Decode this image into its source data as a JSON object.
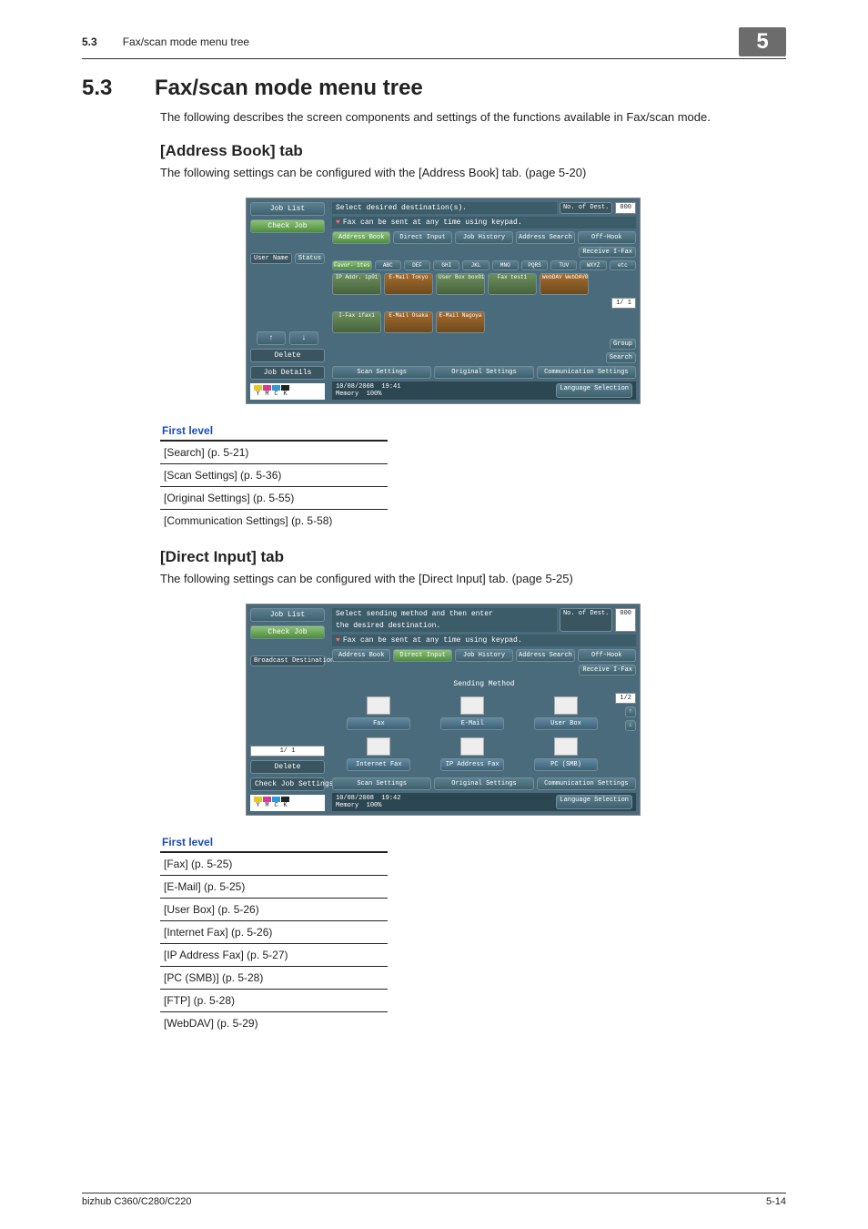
{
  "header": {
    "section_number": "5.3",
    "section_title": "Fax/scan mode menu tree",
    "chapter_badge": "5"
  },
  "h1": {
    "number": "5.3",
    "title": "Fax/scan mode menu tree"
  },
  "intro": "The following describes the screen components and settings of the functions available in Fax/scan mode.",
  "address_tab": {
    "heading": "[Address Book] tab",
    "desc": "The following settings can be configured with the [Address Book] tab. (page 5-20)"
  },
  "direct_tab": {
    "heading": "[Direct Input] tab",
    "desc": "The following settings can be configured with the [Direct Input] tab. (page 5-25)"
  },
  "table_header": "First level",
  "address_levels": [
    "[Search] (p. 5-21)",
    "[Scan Settings] (p. 5-36)",
    "[Original Settings] (p. 5-55)",
    "[Communication Settings] (p. 5-58)"
  ],
  "direct_levels": [
    "[Fax] (p. 5-25)",
    "[E-Mail] (p. 5-25)",
    "[User Box] (p. 5-26)",
    "[Internet Fax] (p. 5-26)",
    "[IP Address Fax] (p. 5-27)",
    "[PC (SMB)] (p. 5-28)",
    "[FTP] (p. 5-28)",
    "[WebDAV] (p. 5-29)"
  ],
  "screen1": {
    "left": {
      "job_list": "Job List",
      "check_job": "Check Job",
      "user_name": "User\nName",
      "status": "Status",
      "delete": "Delete",
      "job_details": "Job Details",
      "ymck": [
        "Y",
        "M",
        "C",
        "K"
      ]
    },
    "msg1": "Select desired destination(s).",
    "dest_count_label": "No. of\nDest.",
    "dest_count": "000",
    "msg2": "Fax can be sent at any time using keypad.",
    "tabs": [
      "Address Book",
      "Direct Input",
      "Job History",
      "Address\nSearch",
      "Off-Hook"
    ],
    "receive_ifax": "Receive\nI-Fax",
    "alpha": [
      "Favor-\nites",
      "ABC",
      "DEF",
      "GHI",
      "JKL",
      "MNO",
      "PQRS",
      "TUV",
      "WXYZ",
      "etc"
    ],
    "dests_row1": [
      {
        "t": "IP Addr.\nip01",
        "c": "green",
        "name": "dest-ip01"
      },
      {
        "t": "E-Mail\nTokyo",
        "c": "email",
        "name": "dest-tokyo"
      },
      {
        "t": "User Box\nbox01",
        "c": "green",
        "name": "dest-box01"
      },
      {
        "t": "Fax\ntest1",
        "c": "green",
        "name": "dest-test1"
      },
      {
        "t": "WebDAV\nWebDAV01",
        "c": "email",
        "name": "dest-webdav01"
      }
    ],
    "dests_row2": [
      {
        "t": "I-Fax\nifax1",
        "c": "green",
        "name": "dest-ifax1"
      },
      {
        "t": "E-Mail\nOsaka",
        "c": "email",
        "name": "dest-osaka"
      },
      {
        "t": "E-Mail\nNagoya",
        "c": "email",
        "name": "dest-nagoya"
      }
    ],
    "page_ind": "1/ 1",
    "group": "Group",
    "search": "Search",
    "bottom_tabs": [
      "Scan Settings",
      "Original Settings",
      "Communication\nSettings"
    ],
    "status_date": "10/08/2008",
    "status_time": "19:41",
    "status_mem": "Memory",
    "status_mem_val": "100%",
    "lang": "Language Selection"
  },
  "screen2": {
    "left": {
      "job_list": "Job List",
      "check_job": "Check Job",
      "broadcast": "Broadcast\nDestinations",
      "page_ind": "1/ 1",
      "delete": "Delete",
      "check_settings": "Check Job\nSettings",
      "ymck": [
        "Y",
        "M",
        "C",
        "K"
      ]
    },
    "msg1a": "Select sending method and then enter",
    "msg1b": "the desired destination.",
    "dest_count_label": "No. of\nDest.",
    "dest_count": "000",
    "msg2": "Fax can be sent at any time using keypad.",
    "tabs": [
      "Address Book",
      "Direct Input",
      "Job History",
      "Address\nSearch",
      "Off-Hook"
    ],
    "receive_ifax": "Receive\nI-Fax",
    "sending_method": "Sending Method",
    "row1": [
      {
        "label": "Fax",
        "name": "method-fax"
      },
      {
        "label": "E-Mail",
        "name": "method-email"
      },
      {
        "label": "User Box",
        "name": "method-userbox"
      }
    ],
    "row2": [
      {
        "label": "Internet Fax",
        "name": "method-ifax"
      },
      {
        "label": "IP Address Fax",
        "name": "method-ipfax"
      },
      {
        "label": "PC (SMB)",
        "name": "method-pcsmb"
      }
    ],
    "page_ind_right": "1/2",
    "bottom_tabs": [
      "Scan Settings",
      "Original Settings",
      "Communication\nSettings"
    ],
    "status_date": "10/08/2008",
    "status_time": "19:42",
    "status_mem": "Memory",
    "status_mem_val": "100%",
    "lang": "Language Selection"
  },
  "footer": {
    "model": "bizhub C360/C280/C220",
    "page": "5-14"
  }
}
